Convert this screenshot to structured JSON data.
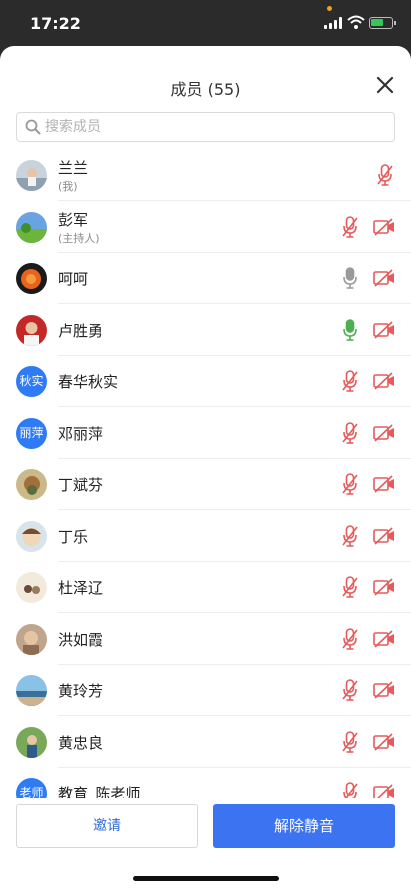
{
  "status_bar": {
    "time": "17:22"
  },
  "header": {
    "title": "成员 (55)"
  },
  "search": {
    "placeholder": "搜索成员",
    "value": ""
  },
  "members": [
    {
      "name": "兰兰",
      "sub": "(我)",
      "avatar": "photo-portrait",
      "mic": "muted",
      "cam": "none"
    },
    {
      "name": "彭军",
      "sub": "(主持人)",
      "avatar": "photo-landscape",
      "mic": "muted",
      "cam": "off"
    },
    {
      "name": "呵呵",
      "sub": "",
      "avatar": "photo-flower",
      "mic": "on",
      "cam": "off"
    },
    {
      "name": "卢胜勇",
      "sub": "",
      "avatar": "photo-face",
      "mic": "on-active",
      "cam": "off"
    },
    {
      "name": "春华秋实",
      "sub": "",
      "avatar": "text",
      "avatar_text": "秋实",
      "mic": "muted",
      "cam": "off"
    },
    {
      "name": "邓丽萍",
      "sub": "",
      "avatar": "text",
      "avatar_text": "丽萍",
      "mic": "muted",
      "cam": "off"
    },
    {
      "name": "丁斌芬",
      "sub": "",
      "avatar": "photo-dog",
      "mic": "muted",
      "cam": "off"
    },
    {
      "name": "丁乐",
      "sub": "",
      "avatar": "photo-cartoon",
      "mic": "muted",
      "cam": "off"
    },
    {
      "name": "杜泽辽",
      "sub": "",
      "avatar": "photo-people",
      "mic": "muted",
      "cam": "off"
    },
    {
      "name": "洪如霞",
      "sub": "",
      "avatar": "photo-woman",
      "mic": "muted",
      "cam": "off"
    },
    {
      "name": "黄玲芳",
      "sub": "",
      "avatar": "photo-sea",
      "mic": "muted",
      "cam": "off"
    },
    {
      "name": "黄忠良",
      "sub": "",
      "avatar": "photo-outdoor",
      "mic": "muted",
      "cam": "off"
    },
    {
      "name": "教育_陈老师",
      "sub": "",
      "avatar": "text",
      "avatar_text": "老师",
      "mic": "muted",
      "cam": "off"
    }
  ],
  "footer": {
    "invite_label": "邀请",
    "unmute_all_label": "解除静音"
  },
  "colors": {
    "accent": "#3b73f0",
    "muted_red": "#e55a5a",
    "mic_active": "#4caf50",
    "icon_gray": "#9a9a9a"
  }
}
